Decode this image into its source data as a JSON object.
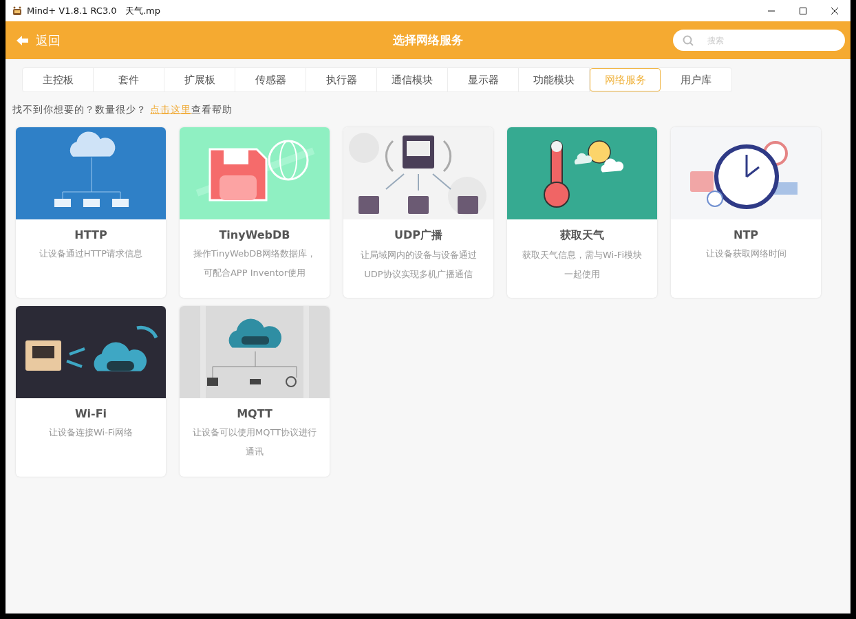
{
  "window": {
    "title": "Mind+ V1.8.1 RC3.0   天气.mp"
  },
  "header": {
    "back": "返回",
    "title": "选择网络服务",
    "search": {
      "placeholder": "搜索"
    }
  },
  "tabs": [
    {
      "label": "主控板",
      "selected": false
    },
    {
      "label": "套件",
      "selected": false
    },
    {
      "label": "扩展板",
      "selected": false
    },
    {
      "label": "传感器",
      "selected": false
    },
    {
      "label": "执行器",
      "selected": false
    },
    {
      "label": "通信模块",
      "selected": false
    },
    {
      "label": "显示器",
      "selected": false
    },
    {
      "label": "功能模块",
      "selected": false
    },
    {
      "label": "网络服务",
      "selected": true
    },
    {
      "label": "用户库",
      "selected": false
    }
  ],
  "help": {
    "before": "找不到你想要的？数量很少？ ",
    "link": "点击这里",
    "after": "查看帮助"
  },
  "cards": [
    {
      "title": "HTTP",
      "description": [
        "让设备通过HTTP请求信息"
      ]
    },
    {
      "title": "TinyWebDB",
      "description": [
        "操作TinyWebDB网络数据库，",
        "可配合APP Inventor使用"
      ]
    },
    {
      "title": "UDP广播",
      "description": [
        "让局域网内的设备与设备通过",
        "UDP协议实现多机广播通信"
      ]
    },
    {
      "title": "获取天气",
      "description": [
        "获取天气信息，需与Wi-Fi模块",
        "一起使用"
      ]
    },
    {
      "title": "NTP",
      "description": [
        "让设备获取网络时间"
      ]
    },
    {
      "title": "Wi-Fi",
      "description": [
        "让设备连接Wi-Fi网络"
      ]
    },
    {
      "title": "MQTT",
      "description": [
        "让设备可以使用MQTT协议进行",
        "通讯"
      ]
    }
  ]
}
